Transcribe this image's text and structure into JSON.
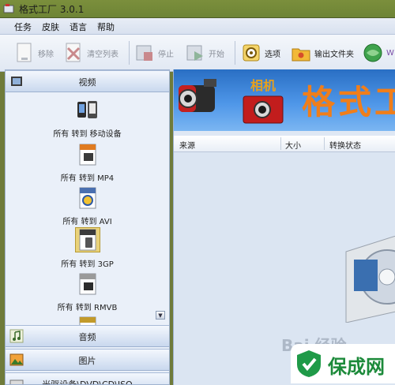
{
  "window": {
    "title": "格式工厂 3.0.1"
  },
  "menu": {
    "items": [
      "任务",
      "皮肤",
      "语言",
      "帮助"
    ]
  },
  "toolbar": {
    "remove": "移除",
    "clear_list": "清空列表",
    "stop": "停止",
    "start": "开始",
    "options": "选项",
    "output_folder": "输出文件夹",
    "web": "W"
  },
  "categories": {
    "video": "视频",
    "audio": "音频",
    "picture": "图片",
    "optical": "光驱设备\\DVD\\CD\\ISO"
  },
  "video_formats": [
    {
      "label": "所有 转到 移动设备",
      "badge": ""
    },
    {
      "label": "所有 转到 MP4",
      "badge": "MP4"
    },
    {
      "label": "所有 转到 AVI",
      "badge": "AVI"
    },
    {
      "label": "所有 转到 3GP",
      "badge": "3GP"
    },
    {
      "label": "所有 转到 RMVB",
      "badge": "RMVB"
    },
    {
      "label": "",
      "badge": "GIF"
    }
  ],
  "banner": {
    "camera_label": "相机",
    "brand": "格式工厂"
  },
  "list": {
    "columns": {
      "source": "来源",
      "size": "大小",
      "status": "转换状态"
    }
  },
  "watermark": "Bai 经验",
  "logo": {
    "text": "保成网"
  },
  "colors": {
    "accent": "#f07e1a",
    "banner_blue": "#2a6fc4",
    "logo_green": "#1c8a3a"
  }
}
